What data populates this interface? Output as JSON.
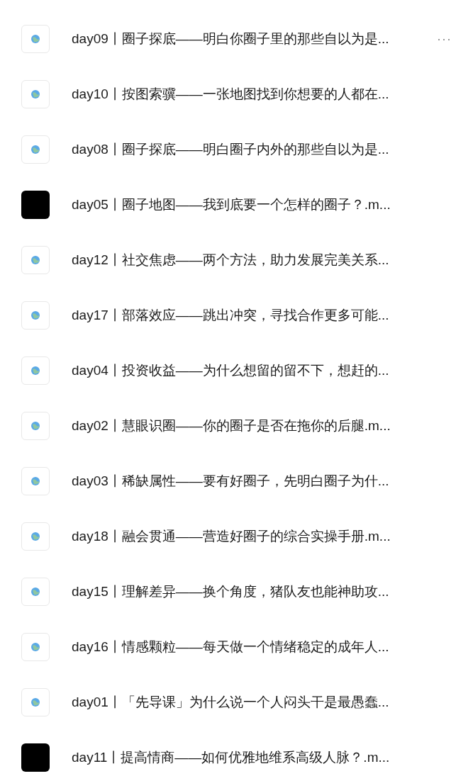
{
  "files": [
    {
      "title": "day09丨圈子探底——明白你圈子里的那些自以为是...",
      "kind": "file",
      "more": "···"
    },
    {
      "title": "day10丨按图索骥——一张地图找到你想要的人都在...",
      "kind": "file"
    },
    {
      "title": "day08丨圈子探底——明白圈子内外的那些自以为是...",
      "kind": "file"
    },
    {
      "title": "day05丨圈子地图——我到底要一个怎样的圈子？.m...",
      "kind": "dark"
    },
    {
      "title": "day12丨社交焦虑——两个方法，助力发展完美关系...",
      "kind": "file"
    },
    {
      "title": "day17丨部落效应——跳出冲突，寻找合作更多可能...",
      "kind": "file"
    },
    {
      "title": "day04丨投资收益——为什么想留的留不下，想赶的...",
      "kind": "file"
    },
    {
      "title": "day02丨慧眼识圈——你的圈子是否在拖你的后腿.m...",
      "kind": "file"
    },
    {
      "title": "day03丨稀缺属性——要有好圈子，先明白圈子为什...",
      "kind": "file"
    },
    {
      "title": "day18丨融会贯通——营造好圈子的综合实操手册.m...",
      "kind": "file"
    },
    {
      "title": "day15丨理解差异——换个角度，猪队友也能神助攻...",
      "kind": "file"
    },
    {
      "title": "day16丨情感颗粒——每天做一个情绪稳定的成年人...",
      "kind": "file"
    },
    {
      "title": "day01丨「先导课」为什么说一个人闷头干是最愚蠢...",
      "kind": "file"
    },
    {
      "title": "day11丨提高情商——如何优雅地维系高级人脉？.m...",
      "kind": "dark"
    }
  ]
}
